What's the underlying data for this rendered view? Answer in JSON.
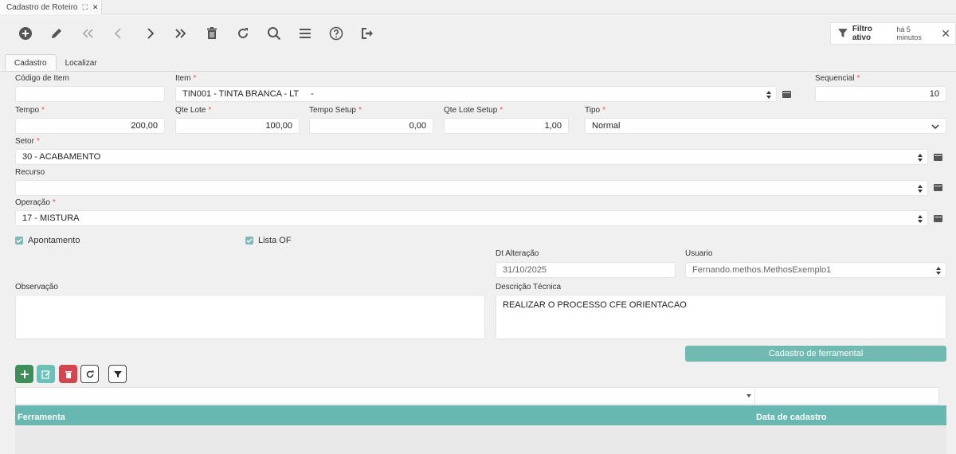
{
  "window": {
    "tab_title": "Cadastro de Roteiro"
  },
  "toolbar": {
    "buttons": [
      {
        "icon": "add-circle-icon",
        "enabled": true
      },
      {
        "icon": "pencil-icon",
        "enabled": true
      },
      {
        "icon": "double-chevron-left-icon",
        "enabled": false
      },
      {
        "icon": "chevron-left-icon",
        "enabled": false
      },
      {
        "icon": "chevron-right-icon",
        "enabled": true
      },
      {
        "icon": "double-chevron-right-icon",
        "enabled": true
      },
      {
        "icon": "trash-icon",
        "enabled": true
      },
      {
        "icon": "refresh-icon",
        "enabled": true
      },
      {
        "icon": "search-icon",
        "enabled": true
      },
      {
        "icon": "menu-icon",
        "enabled": true
      },
      {
        "icon": "help-icon",
        "enabled": true
      },
      {
        "icon": "exit-icon",
        "enabled": true
      }
    ]
  },
  "filter": {
    "title": "Filtro ativo",
    "time": "há 5 minutos"
  },
  "tabs": [
    "Cadastro",
    "Localizar"
  ],
  "form": {
    "codigo_item": {
      "label": "Código de Item",
      "value": ""
    },
    "item": {
      "label": "Item",
      "value": "TIN001 - TINTA BRANCA - LT     -"
    },
    "sequencial": {
      "label": "Sequencial",
      "value": "10"
    },
    "tempo": {
      "label": "Tempo",
      "value": "200,00"
    },
    "qte_lote": {
      "label": "Qte Lote",
      "value": "100,00"
    },
    "tempo_setup": {
      "label": "Tempo Setup",
      "value": "0,00"
    },
    "qte_lote_setup": {
      "label": "Qte Lote Setup",
      "value": "1,00"
    },
    "tipo": {
      "label": "Tipo",
      "value": "Normal"
    },
    "setor": {
      "label": "Setor",
      "value": "30 - ACABAMENTO"
    },
    "recurso": {
      "label": "Recurso",
      "value": ""
    },
    "operacao": {
      "label": "Operação",
      "value": "17 - MISTURA"
    },
    "apontamento": {
      "label": "Apontamento",
      "checked": true
    },
    "lista_of": {
      "label": "Lista OF",
      "checked": true
    },
    "dt_alteracao": {
      "label": "Dt Alteração",
      "value": "31/10/2025"
    },
    "usuario": {
      "label": "Usuario",
      "value": "Fernando.methos.MethosExemplo1"
    },
    "observacao": {
      "label": "Observação",
      "value": ""
    },
    "descricao_tecnica": {
      "label": "Descrição Técnica",
      "value": "REALIZAR O PROCESSO CFE ORIENTACAO"
    },
    "required_mark": "*"
  },
  "ferramental_button": "Cadastro de ferramental",
  "grid": {
    "columns": [
      "Ferramenta",
      "Data de cadastro"
    ],
    "rows": []
  },
  "colors": {
    "accent": "#67b8b0",
    "add_button": "#3e8e5a",
    "edit_button": "#6cc0b8",
    "delete_button": "#d2474f",
    "required": "#d9534f"
  }
}
